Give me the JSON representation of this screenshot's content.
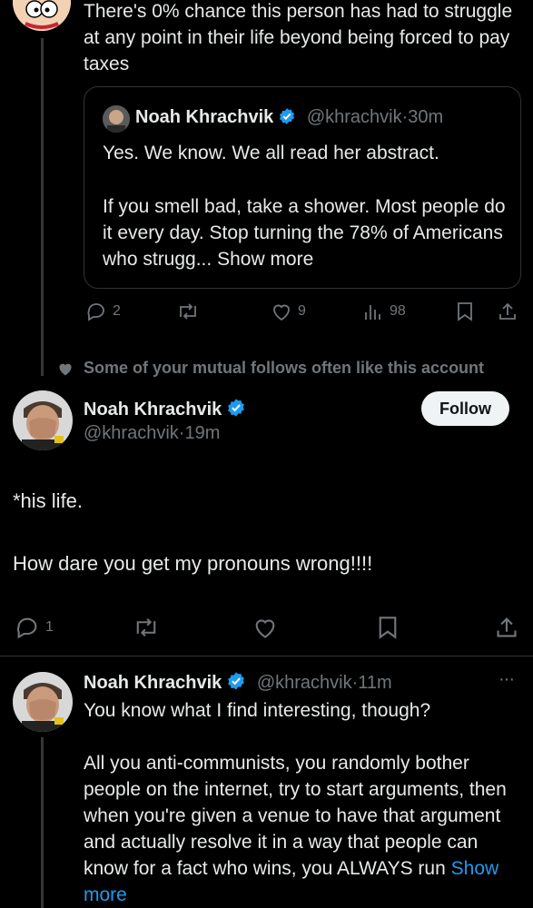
{
  "tweet1": {
    "text": "There's 0% chance this person has had to struggle at any point in their life beyond being forced to pay taxes",
    "quote": {
      "name": "Noah Khrachvik",
      "handle": "@khrachvik",
      "time": "30m",
      "line1": "Yes. We know. We all read her abstract.",
      "line2": "If you smell bad, take a shower. Most people do it every day. Stop turning the 78% of Americans who strugg...",
      "show_more": "Show more"
    },
    "actions": {
      "replies": "2",
      "retweets": "",
      "likes": "9",
      "views": "98"
    }
  },
  "social_context": "Some of your mutual follows often like this account",
  "tweet2": {
    "name": "Noah Khrachvik",
    "handle": "@khrachvik",
    "time": "19m",
    "follow_label": "Follow",
    "line1": "*his life.",
    "line2": "How dare you get my pronouns wrong!!!!",
    "actions": {
      "replies": "1"
    }
  },
  "tweet3": {
    "name": "Noah Khrachvik",
    "handle": "@khrachvik",
    "time": "11m",
    "line1": "You know what I find interesting, though?",
    "line2": "All you anti-communists, you randomly bother people on the internet, try to start arguments, then when you're given a venue to have that argument and actually resolve it in a way that people can know for a fact who wins, you ALWAYS run",
    "show_more": "Show more",
    "more_label": "···"
  },
  "colors": {
    "accent": "#1d9bf0",
    "muted": "#71767b",
    "background": "#000000"
  }
}
